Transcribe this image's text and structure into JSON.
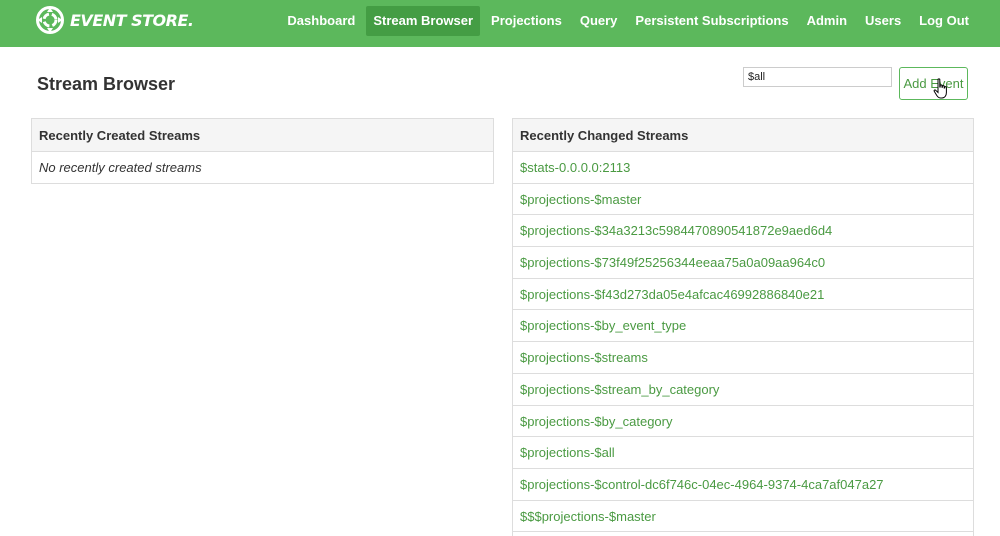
{
  "header": {
    "logo_text": "EVENT STORE.",
    "nav": [
      {
        "label": "Dashboard",
        "active": false
      },
      {
        "label": "Stream Browser",
        "active": true
      },
      {
        "label": "Projections",
        "active": false
      },
      {
        "label": "Query",
        "active": false
      },
      {
        "label": "Persistent Subscriptions",
        "active": false
      },
      {
        "label": "Admin",
        "active": false
      },
      {
        "label": "Users",
        "active": false
      },
      {
        "label": "Log Out",
        "active": false
      }
    ]
  },
  "page": {
    "title": "Stream Browser",
    "stream_input_value": "$all",
    "add_event_label": "Add Event"
  },
  "recently_created": {
    "heading": "Recently Created Streams",
    "empty_text": "No recently created streams"
  },
  "recently_changed": {
    "heading": "Recently Changed Streams",
    "streams": [
      "$stats-0.0.0.0:2113",
      "$projections-$master",
      "$projections-$34a3213c5984470890541872e9aed6d4",
      "$projections-$73f49f25256344eeaa75a0a09aa964c0",
      "$projections-$f43d273da05e4afcac46992886840e21",
      "$projections-$by_event_type",
      "$projections-$streams",
      "$projections-$stream_by_category",
      "$projections-$by_category",
      "$projections-$all",
      "$projections-$control-dc6f746c-04ec-4964-9374-4ca7af047a27",
      "$$$projections-$master"
    ]
  },
  "colors": {
    "brand_green": "#5cb85c",
    "active_nav": "#449d44",
    "link_green": "#4a9a42"
  }
}
